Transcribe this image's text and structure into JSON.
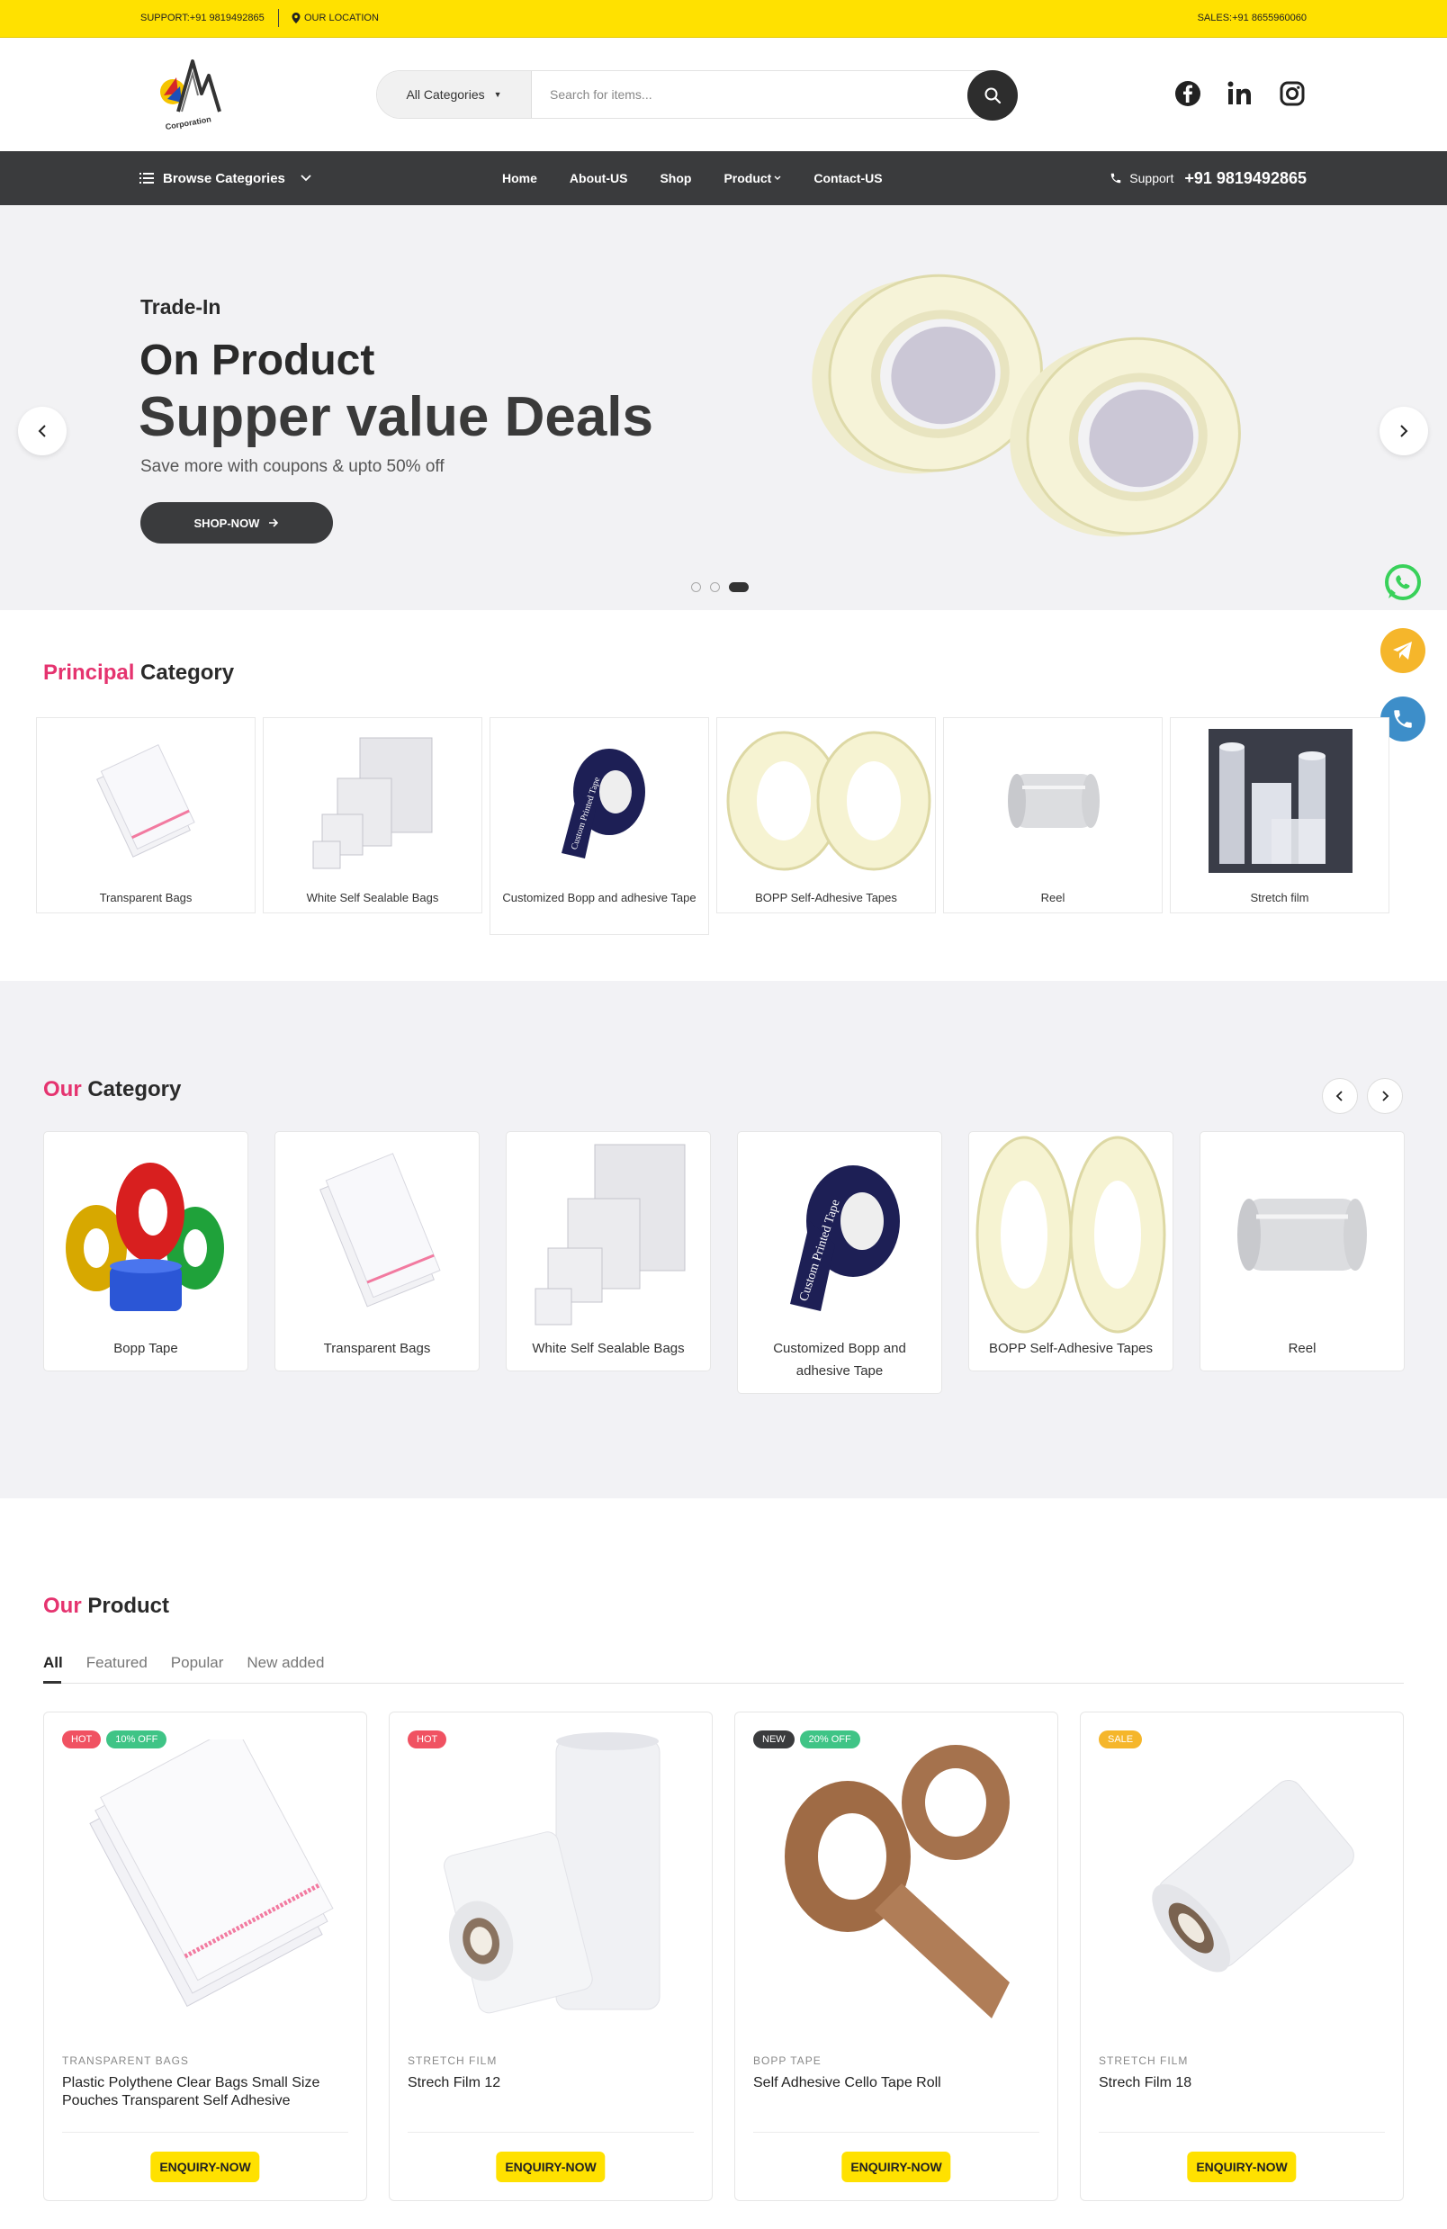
{
  "topbar": {
    "support": "SUPPORT:+91 9819492865",
    "location": "OUR LOCATION",
    "sales": "SALES:+91 8655960060"
  },
  "header": {
    "category_select": "All Categories",
    "search_placeholder": "Search for items..."
  },
  "nav": {
    "browse": "Browse Categories",
    "menu": [
      "Home",
      "About-US",
      "Shop",
      "Product",
      "Contact-US"
    ],
    "support_label": "Support",
    "support_number": "+91 9819492865"
  },
  "hero": {
    "kicker": "Trade-In",
    "title1": "On Product",
    "title2": "Supper value Deals",
    "subtitle": "Save more with coupons & upto 50% off",
    "cta": "SHOP-NOW",
    "active_slide": 3,
    "slide_count": 3
  },
  "principal": {
    "title_accent": "Principal",
    "title_rest": " Category",
    "items": [
      "Transparent Bags",
      "White Self Sealable Bags",
      "Customized Bopp and adhesive Tape",
      "BOPP Self-Adhesive Tapes",
      "Reel",
      "Stretch film"
    ]
  },
  "our_category": {
    "title_accent": "Our",
    "title_rest": " Category",
    "items": [
      "Bopp Tape",
      "Transparent Bags",
      "White Self Sealable Bags",
      "Customized Bopp and adhesive Tape",
      "BOPP Self-Adhesive Tapes",
      "Reel"
    ]
  },
  "our_product": {
    "title_accent": "Our",
    "title_rest": " Product",
    "tabs": [
      "All",
      "Featured",
      "Popular",
      "New added"
    ],
    "products": [
      {
        "badges": [
          "HOT",
          "10% OFF"
        ],
        "category": "TRANSPARENT BAGS",
        "name": "Plastic Polythene Clear Bags Small Size Pouches Transparent Self Adhesive",
        "cta": "ENQUIRY-NOW"
      },
      {
        "badges": [
          "HOT"
        ],
        "category": "STRETCH FILM",
        "name": "Strech Film 12",
        "cta": "ENQUIRY-NOW"
      },
      {
        "badges": [
          "NEW",
          "20% OFF"
        ],
        "category": "BOPP TAPE",
        "name": "Self Adhesive Cello Tape Roll",
        "cta": "ENQUIRY-NOW"
      },
      {
        "badges": [
          "SALE"
        ],
        "category": "STRETCH FILM",
        "name": "Strech Film 18",
        "cta": "ENQUIRY-NOW"
      }
    ]
  },
  "colors": {
    "accent_yellow": "#ffe100",
    "dark": "#3a3b3d",
    "pink": "#e5336f",
    "hot": "#f05262",
    "off": "#3fc486",
    "sale": "#f5b62b"
  },
  "icons": [
    "location-pin-icon",
    "search-icon",
    "facebook-icon",
    "linkedin-icon",
    "instagram-icon",
    "list-icon",
    "chevron-down-icon",
    "phone-icon",
    "chevron-left-icon",
    "chevron-right-icon",
    "arrow-right-icon",
    "whatsapp-icon",
    "telegram-icon"
  ]
}
